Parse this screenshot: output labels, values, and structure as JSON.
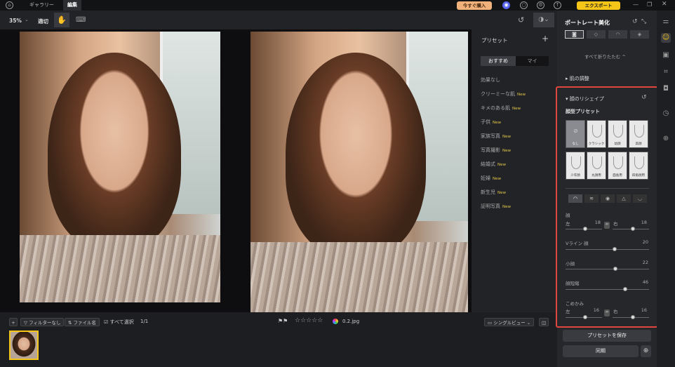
{
  "topbar": {
    "tab_gallery": "ギャラリー",
    "tab_edit": "編集",
    "buy_label": "今すぐ購入",
    "export_label": "エクスポート"
  },
  "toolbar": {
    "zoom": "35%",
    "fit": "適切"
  },
  "preset_panel": {
    "title": "プリセット",
    "tab_recommended": "おすすめ",
    "tab_mine": "マイ",
    "new_badge": "New",
    "items": [
      {
        "label": "効果なし",
        "new": false
      },
      {
        "label": "クリーミーな肌",
        "new": true
      },
      {
        "label": "キメのある肌",
        "new": true
      },
      {
        "label": "子供",
        "new": true
      },
      {
        "label": "家族写真",
        "new": true
      },
      {
        "label": "写真撮影",
        "new": true
      },
      {
        "label": "結婚式",
        "new": true
      },
      {
        "label": "妊婦",
        "new": true
      },
      {
        "label": "新生児",
        "new": true
      },
      {
        "label": "証明写真",
        "new": true
      }
    ]
  },
  "bottombar": {
    "filter": "フィルターなし",
    "filename": "ファイル名",
    "select_all": "すべて選択",
    "count": "1/1",
    "stars": "☆☆☆☆☆",
    "file": "0.2.jpg",
    "view": "シングルビュー"
  },
  "right_panel": {
    "title": "ポートレート美化",
    "collapse_all": "すべて折りたたむ ^",
    "skin": "肌の調整",
    "reshape": "顔のリシェイプ",
    "preset_heading": "顔型プリセット",
    "face_presets": [
      "なし",
      "クラシック",
      "幼顔",
      "高顔",
      "少年顔",
      "丸顔用",
      "面長用",
      "四角顔用"
    ],
    "sliders": {
      "face_label": "顔",
      "left": "左",
      "right": "右",
      "face_left": "18",
      "face_right": "18",
      "vline_label": "Vライン 顔",
      "vline": "20",
      "small_label": "小顔",
      "small": "22",
      "short_label": "顔短縮",
      "short": "46",
      "temple_label": "こめかみ",
      "temple_left": "16",
      "temple_right": "16"
    },
    "save_preset": "プリセットを保存",
    "sync": "同期"
  },
  "colors": {
    "accent": "#e0463e",
    "export": "#f5c518",
    "buy": "#e8a255"
  }
}
